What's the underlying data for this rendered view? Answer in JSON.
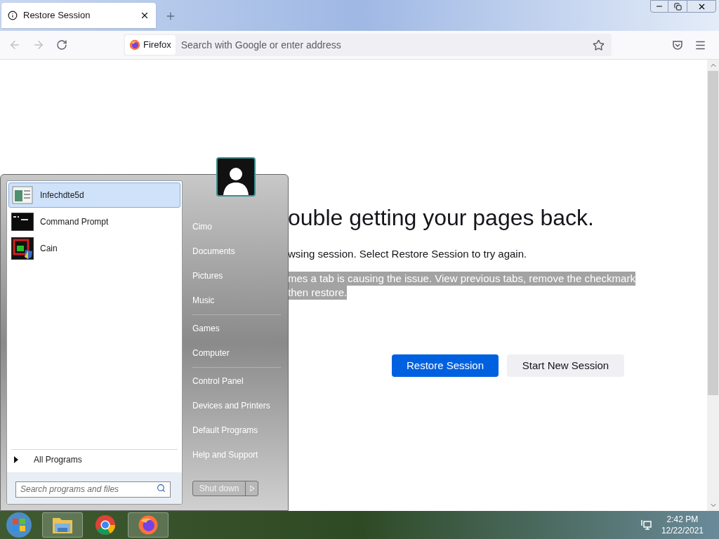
{
  "tabs": [
    {
      "label": "Restore Session",
      "selected": true
    }
  ],
  "toolbar": {
    "identity": "Firefox",
    "address_placeholder": "Search with Google or enter address"
  },
  "page": {
    "heading": "ouble getting your pages back.",
    "lines": [
      {
        "text": "wsing session. Select Restore Session to try again.",
        "highlighted": false
      },
      {
        "text": "mes a tab is causing the issue. View previous tabs, remove the checkmark",
        "highlighted": true
      },
      {
        "text": "then restore.",
        "highlighted": true
      }
    ],
    "buttons": [
      {
        "label": "Restore Session",
        "kind": "primary"
      },
      {
        "label": "Start New Session",
        "kind": "secondary"
      }
    ]
  },
  "start_menu": {
    "programs": [
      {
        "label": "Infechdte5d",
        "kind": "document",
        "selected": true
      },
      {
        "label": "Command Prompt",
        "kind": "console",
        "selected": false
      },
      {
        "label": "Cain",
        "kind": "cain",
        "selected": false
      }
    ],
    "all_programs": "All Programs",
    "search_placeholder": "Search programs and files",
    "places": [
      [
        "Cimo",
        "Documents",
        "Pictures",
        "Music"
      ],
      [
        "Games",
        "Computer"
      ],
      [
        "Control Panel",
        "Devices and Printers",
        "Default Programs",
        "Help and Support"
      ]
    ],
    "shutdown": "Shut down"
  },
  "taskbar": {
    "apps": [
      {
        "kind": "explorer",
        "running": true
      },
      {
        "kind": "chrome",
        "running": false
      },
      {
        "kind": "firefox",
        "running": true
      }
    ],
    "time": "2:42 PM",
    "date": "12/22/2021"
  }
}
